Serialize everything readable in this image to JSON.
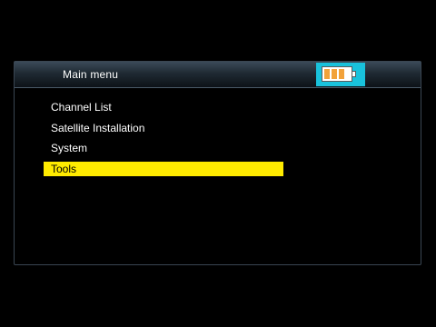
{
  "header": {
    "title": "Main menu",
    "battery_icon": "battery-icon",
    "battery_level": 0.75,
    "accent_color": "#19c2dc",
    "battery_fill_color": "#f2a23a"
  },
  "menu": {
    "items": [
      {
        "label": "Channel List",
        "selected": false
      },
      {
        "label": "Satellite Installation",
        "selected": false
      },
      {
        "label": "System",
        "selected": false
      },
      {
        "label": "Tools",
        "selected": true
      }
    ],
    "selected_color": "#ffeb00"
  }
}
